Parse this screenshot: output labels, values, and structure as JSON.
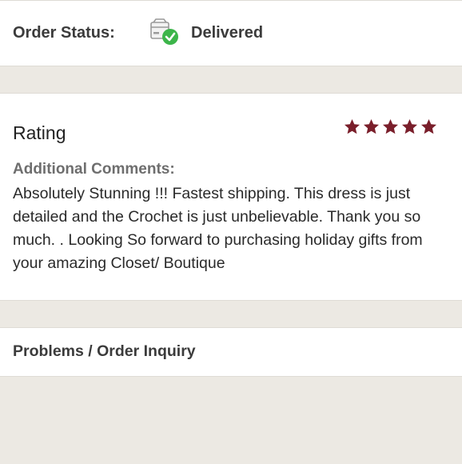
{
  "order_status": {
    "label": "Order Status:",
    "icon": "package-delivered-icon",
    "value": "Delivered",
    "check_color": "#3cb54a"
  },
  "rating": {
    "title": "Rating",
    "stars": 5,
    "star_color": "#7a1f2b",
    "comments_label": "Additional Comments:",
    "comments_text": "Absolutely Stunning !!! Fastest shipping. This dress is just detailed and the Crochet is just unbelievable. Thank you so much. . Looking So forward to purchasing holiday gifts from your amazing Closet/ Boutique"
  },
  "problems": {
    "label": "Problems / Order Inquiry"
  }
}
